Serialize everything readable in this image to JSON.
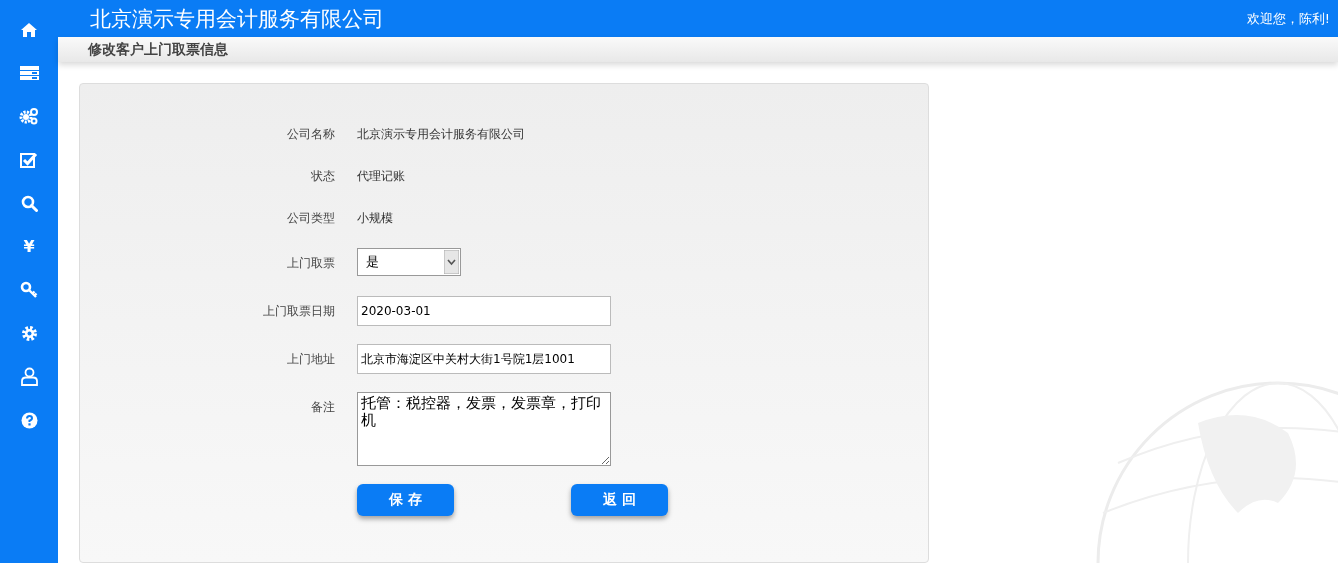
{
  "header": {
    "title": "北京演示专用会计服务有限公司",
    "welcome": "欢迎您，陈利!"
  },
  "sidebar": {
    "items": [
      {
        "kind": "home"
      },
      {
        "kind": "server"
      },
      {
        "kind": "gears"
      },
      {
        "kind": "checkbox"
      },
      {
        "kind": "search"
      },
      {
        "kind": "glyph",
        "text": "¥"
      },
      {
        "kind": "key"
      },
      {
        "kind": "gear"
      },
      {
        "kind": "user"
      },
      {
        "kind": "help"
      }
    ]
  },
  "page_title": "修改客户上门取票信息",
  "form": {
    "fields": [
      {
        "kind": "text",
        "label": "公司名称",
        "value": "北京演示专用会计服务有限公司"
      },
      {
        "kind": "text",
        "label": "状态",
        "value": "代理记账"
      },
      {
        "kind": "text",
        "label": "公司类型",
        "value": "小规模"
      },
      {
        "kind": "select",
        "label": "上门取票",
        "value": "是"
      },
      {
        "kind": "input",
        "label": "上门取票日期",
        "value": "2020-03-01"
      },
      {
        "kind": "input",
        "label": "上门地址",
        "value": "北京市海淀区中关村大街1号院1层1001"
      },
      {
        "kind": "textarea",
        "label": "备注",
        "value": "托管：税控器，发票，发票章，打印机"
      }
    ],
    "buttons": [
      "保 存",
      "返 回"
    ]
  }
}
